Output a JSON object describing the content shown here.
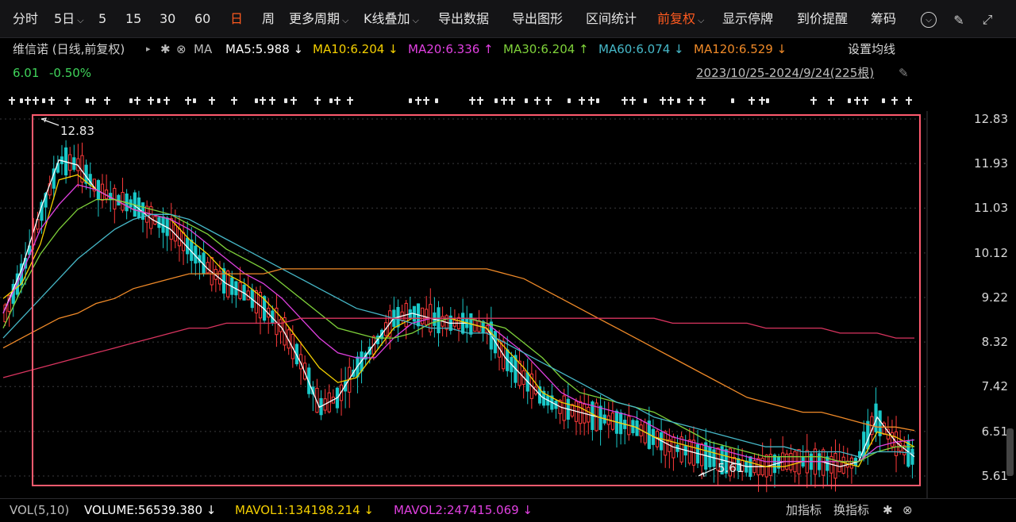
{
  "toolbar": {
    "items": [
      "分时",
      "5日",
      "5",
      "15",
      "30",
      "60",
      "日",
      "周",
      "更多周期",
      "K线叠加",
      "导出数据",
      "导出图形",
      "区间统计",
      "前复权",
      "显示停牌",
      "到价提醒",
      "筹码"
    ],
    "active": [
      "日",
      "前复权"
    ]
  },
  "info": {
    "stock": "维信诺 (日线,前复权)",
    "ma_label": "MA",
    "ma5": "MA5:5.988 ↓",
    "ma10": "MA10:6.204 ↓",
    "ma20": "MA20:6.336 ↑",
    "ma30": "MA30:6.204 ↑",
    "ma60": "MA60:6.074 ↓",
    "ma120": "MA120:6.529 ↓",
    "set_ma": "设置均线",
    "price": "6.01",
    "change": "-0.50%",
    "range": "2023/10/25-2024/9/24(225根)"
  },
  "colors": {
    "up": "#ff3a3a",
    "down": "#19c8c8",
    "ma5": "#ffffff",
    "ma10": "#f5d000",
    "ma20": "#e040e0",
    "ma30": "#7fd23a",
    "ma60": "#46b8c8",
    "ma120": "#f08a28",
    "ma250": "#d9345f",
    "highlight": "#ff5a6e"
  },
  "chart_data": {
    "type": "candlestick",
    "y_ticks": [
      "12.83",
      "11.93",
      "11.03",
      "10.12",
      "9.22",
      "8.32",
      "7.42",
      "6.51",
      "5.61"
    ],
    "ylim": [
      5.61,
      12.83
    ],
    "high_label": "12.83",
    "low_label": "5.61",
    "ma_series": [
      {
        "name": "MA5",
        "values": [
          8.9,
          9.8,
          11.0,
          12.0,
          11.9,
          11.4,
          11.2,
          11.1,
          10.8,
          10.6,
          10.2,
          9.8,
          9.5,
          9.3,
          9.0,
          8.6,
          7.9,
          7.0,
          7.2,
          7.8,
          8.3,
          8.8,
          8.9,
          8.8,
          8.7,
          8.7,
          8.6,
          8.0,
          7.6,
          7.2,
          7.0,
          6.9,
          6.8,
          6.7,
          6.6,
          6.4,
          6.2,
          6.1,
          6.0,
          5.9,
          5.8,
          5.8,
          5.9,
          5.9,
          5.9,
          5.8,
          5.9,
          6.8,
          6.3,
          6.0
        ]
      },
      {
        "name": "MA10",
        "values": [
          9.2,
          9.5,
          10.3,
          11.6,
          11.7,
          11.4,
          11.2,
          11.0,
          10.9,
          10.8,
          10.4,
          10.1,
          9.7,
          9.5,
          9.2,
          8.8,
          8.3,
          7.8,
          7.5,
          7.6,
          8.1,
          8.6,
          8.8,
          8.8,
          8.8,
          8.7,
          8.6,
          8.2,
          7.8,
          7.3,
          7.1,
          7.0,
          6.8,
          6.7,
          6.6,
          6.4,
          6.3,
          6.2,
          6.1,
          6.0,
          5.9,
          5.8,
          5.8,
          5.9,
          5.9,
          5.9,
          5.8,
          6.5,
          6.4,
          6.2
        ]
      },
      {
        "name": "MA20",
        "values": [
          8.9,
          9.7,
          10.6,
          11.1,
          11.5,
          11.4,
          11.2,
          11.0,
          10.9,
          10.8,
          10.6,
          10.3,
          10.0,
          9.7,
          9.5,
          9.2,
          8.8,
          8.4,
          8.1,
          8.0,
          8.0,
          8.4,
          8.7,
          8.8,
          8.8,
          8.8,
          8.7,
          8.4,
          8.1,
          7.7,
          7.3,
          7.1,
          7.0,
          6.9,
          6.8,
          6.6,
          6.4,
          6.3,
          6.2,
          6.1,
          6.0,
          5.9,
          5.9,
          5.9,
          5.9,
          5.9,
          5.9,
          6.2,
          6.3,
          6.34
        ]
      },
      {
        "name": "MA30",
        "values": [
          8.6,
          9.4,
          10.1,
          10.6,
          11.0,
          11.2,
          11.2,
          11.1,
          11.0,
          10.9,
          10.7,
          10.5,
          10.2,
          10.0,
          9.8,
          9.5,
          9.2,
          8.9,
          8.6,
          8.5,
          8.4,
          8.4,
          8.5,
          8.7,
          8.8,
          8.8,
          8.7,
          8.6,
          8.3,
          8.0,
          7.6,
          7.3,
          7.2,
          7.1,
          7.0,
          6.9,
          6.7,
          6.5,
          6.3,
          6.2,
          6.1,
          6.0,
          6.0,
          6.0,
          6.0,
          5.9,
          5.9,
          6.1,
          6.2,
          6.2
        ]
      },
      {
        "name": "MA60",
        "values": [
          8.4,
          8.8,
          9.2,
          9.6,
          10.0,
          10.3,
          10.6,
          10.8,
          10.9,
          10.9,
          10.8,
          10.6,
          10.4,
          10.2,
          10.0,
          9.8,
          9.6,
          9.4,
          9.2,
          9.0,
          8.9,
          8.8,
          8.7,
          8.6,
          8.6,
          8.5,
          8.5,
          8.3,
          8.1,
          7.9,
          7.7,
          7.5,
          7.3,
          7.1,
          7.0,
          6.8,
          6.7,
          6.6,
          6.5,
          6.4,
          6.3,
          6.2,
          6.2,
          6.1,
          6.1,
          6.1,
          6.0,
          6.1,
          6.1,
          6.07
        ]
      },
      {
        "name": "MA120",
        "values": [
          8.2,
          8.4,
          8.6,
          8.8,
          8.9,
          9.1,
          9.2,
          9.4,
          9.5,
          9.6,
          9.7,
          9.7,
          9.7,
          9.7,
          9.7,
          9.8,
          9.8,
          9.8,
          9.8,
          9.8,
          9.8,
          9.8,
          9.8,
          9.8,
          9.8,
          9.8,
          9.8,
          9.7,
          9.6,
          9.4,
          9.2,
          9.0,
          8.8,
          8.6,
          8.4,
          8.2,
          8.0,
          7.8,
          7.6,
          7.4,
          7.2,
          7.1,
          7.0,
          6.9,
          6.9,
          6.8,
          6.7,
          6.6,
          6.6,
          6.53
        ]
      },
      {
        "name": "MA250",
        "values": [
          7.6,
          7.7,
          7.8,
          7.9,
          8.0,
          8.1,
          8.2,
          8.3,
          8.4,
          8.5,
          8.6,
          8.6,
          8.7,
          8.7,
          8.7,
          8.7,
          8.8,
          8.8,
          8.8,
          8.8,
          8.8,
          8.8,
          8.8,
          8.8,
          8.8,
          8.8,
          8.8,
          8.8,
          8.8,
          8.8,
          8.8,
          8.8,
          8.8,
          8.8,
          8.8,
          8.8,
          8.7,
          8.7,
          8.7,
          8.7,
          8.7,
          8.6,
          8.6,
          8.6,
          8.6,
          8.5,
          8.5,
          8.5,
          8.4,
          8.4
        ]
      }
    ]
  },
  "vol": {
    "label": "VOL(5,10)",
    "volume": "VOLUME:56539.380 ↓",
    "mavol1": "MAVOL1:134198.214 ↓",
    "mavol2": "MAVOL2:247415.069 ↓",
    "add_indicator": "加指标",
    "switch_indicator": "换指标"
  }
}
